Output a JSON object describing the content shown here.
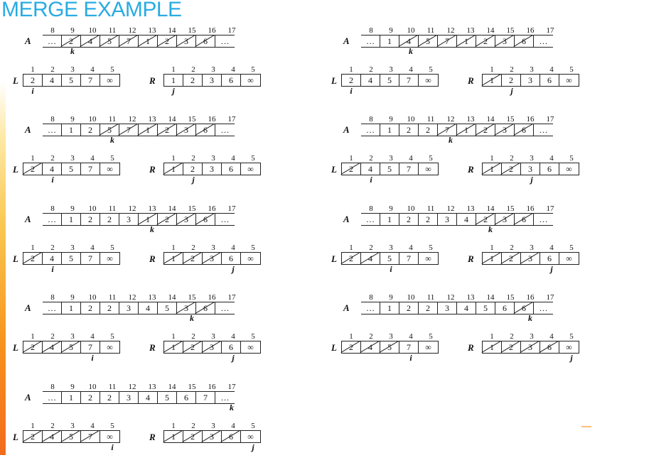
{
  "title": "MERGE EXAMPLE",
  "labels": {
    "A": "A",
    "L": "L",
    "R": "R",
    "i": "i",
    "j": "j",
    "k": "k"
  },
  "a_indices": [
    "8",
    "9",
    "10",
    "11",
    "12",
    "13",
    "14",
    "15",
    "16",
    "17"
  ],
  "lr_indices": [
    "1",
    "2",
    "3",
    "4",
    "5"
  ],
  "panels": [
    {
      "A": [
        "…",
        "2",
        "4",
        "5",
        "7",
        "1",
        "2",
        "3",
        "6",
        "…"
      ],
      "A_crossed": [
        1,
        2,
        3,
        4,
        5,
        6,
        7,
        8
      ],
      "k": 1,
      "L": [
        "2",
        "4",
        "5",
        "7",
        "∞"
      ],
      "L_crossed": [],
      "i": 0,
      "R": [
        "1",
        "2",
        "3",
        "6",
        "∞"
      ],
      "R_crossed": [],
      "j": 0
    },
    {
      "A": [
        "…",
        "1",
        "4",
        "5",
        "7",
        "1",
        "2",
        "3",
        "6",
        "…"
      ],
      "A_crossed": [
        2,
        3,
        4,
        5,
        6,
        7,
        8
      ],
      "k": 2,
      "L": [
        "2",
        "4",
        "5",
        "7",
        "∞"
      ],
      "L_crossed": [],
      "i": 0,
      "R": [
        "1",
        "2",
        "3",
        "6",
        "∞"
      ],
      "R_crossed": [
        0
      ],
      "j": 1
    },
    {
      "A": [
        "…",
        "1",
        "2",
        "5",
        "7",
        "1",
        "2",
        "3",
        "6",
        "…"
      ],
      "A_crossed": [
        3,
        4,
        5,
        6,
        7,
        8
      ],
      "k": 3,
      "L": [
        "2",
        "4",
        "5",
        "7",
        "∞"
      ],
      "L_crossed": [
        0
      ],
      "i": 1,
      "R": [
        "1",
        "2",
        "3",
        "6",
        "∞"
      ],
      "R_crossed": [
        0
      ],
      "j": 1
    },
    {
      "A": [
        "…",
        "1",
        "2",
        "2",
        "7",
        "1",
        "2",
        "3",
        "6",
        "…"
      ],
      "A_crossed": [
        4,
        5,
        6,
        7,
        8
      ],
      "k": 4,
      "L": [
        "2",
        "4",
        "5",
        "7",
        "∞"
      ],
      "L_crossed": [
        0
      ],
      "i": 1,
      "R": [
        "1",
        "2",
        "3",
        "6",
        "∞"
      ],
      "R_crossed": [
        0,
        1
      ],
      "j": 2
    },
    {
      "A": [
        "…",
        "1",
        "2",
        "2",
        "3",
        "1",
        "2",
        "3",
        "6",
        "…"
      ],
      "A_crossed": [
        5,
        6,
        7,
        8
      ],
      "k": 5,
      "L": [
        "2",
        "4",
        "5",
        "7",
        "∞"
      ],
      "L_crossed": [
        0
      ],
      "i": 1,
      "R": [
        "1",
        "2",
        "3",
        "6",
        "∞"
      ],
      "R_crossed": [
        0,
        1,
        2
      ],
      "j": 3
    },
    {
      "A": [
        "…",
        "1",
        "2",
        "2",
        "3",
        "4",
        "2",
        "3",
        "6",
        "…"
      ],
      "A_crossed": [
        6,
        7,
        8
      ],
      "k": 6,
      "L": [
        "2",
        "4",
        "5",
        "7",
        "∞"
      ],
      "L_crossed": [
        0,
        1
      ],
      "i": 2,
      "R": [
        "1",
        "2",
        "3",
        "6",
        "∞"
      ],
      "R_crossed": [
        0,
        1,
        2
      ],
      "j": 3
    },
    {
      "A": [
        "…",
        "1",
        "2",
        "2",
        "3",
        "4",
        "5",
        "3",
        "6",
        "…"
      ],
      "A_crossed": [
        7,
        8
      ],
      "k": 7,
      "L": [
        "2",
        "4",
        "5",
        "7",
        "∞"
      ],
      "L_crossed": [
        0,
        1,
        2
      ],
      "i": 3,
      "R": [
        "1",
        "2",
        "3",
        "6",
        "∞"
      ],
      "R_crossed": [
        0,
        1,
        2
      ],
      "j": 3
    },
    {
      "A": [
        "…",
        "1",
        "2",
        "2",
        "3",
        "4",
        "5",
        "6",
        "6",
        "…"
      ],
      "A_crossed": [
        8
      ],
      "k": 8,
      "L": [
        "2",
        "4",
        "5",
        "7",
        "∞"
      ],
      "L_crossed": [
        0,
        1,
        2
      ],
      "i": 3,
      "R": [
        "1",
        "2",
        "3",
        "6",
        "∞"
      ],
      "R_crossed": [
        0,
        1,
        2,
        3
      ],
      "j": 4
    },
    {
      "A": [
        "…",
        "1",
        "2",
        "2",
        "3",
        "4",
        "5",
        "6",
        "7",
        "…"
      ],
      "A_crossed": [],
      "k": 9,
      "L": [
        "2",
        "4",
        "5",
        "7",
        "∞"
      ],
      "L_crossed": [
        0,
        1,
        2,
        3
      ],
      "i": 4,
      "R": [
        "1",
        "2",
        "3",
        "6",
        "∞"
      ],
      "R_crossed": [
        0,
        1,
        2,
        3
      ],
      "j": 4
    }
  ]
}
